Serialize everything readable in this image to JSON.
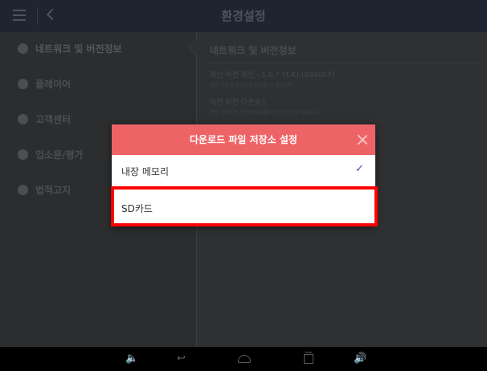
{
  "header": {
    "title": "환경설정"
  },
  "sidebar": {
    "items": [
      {
        "label": "네트워크 및 버전정보",
        "icon": "wifi-icon"
      },
      {
        "label": "플레이어",
        "icon": "play-icon"
      },
      {
        "label": "고객센터",
        "icon": "headset-icon"
      },
      {
        "label": "입소문/평가",
        "icon": "chat-icon"
      },
      {
        "label": "법적고지",
        "icon": "info-icon"
      }
    ]
  },
  "content": {
    "heading": "네트워크 및 버전정보",
    "rows": [
      {
        "title": "최신 버전 확인 - 1.0.7 (T-K) (934007)",
        "desc": "최신 버전을 확인하고 설치할 수 있습니다."
      },
      {
        "title": "이전 버전 다운로드",
        "desc": "최신 업데이트 이전의 파일을 다운로드 할 수 있습니다."
      }
    ]
  },
  "dialog": {
    "title": "다운로드 파일 저장소 설정",
    "options": [
      {
        "label": "내장 메모리",
        "selected": true
      },
      {
        "label": "SD카드",
        "selected": false
      }
    ],
    "check_glyph": "✓"
  },
  "navbar": {
    "volume_down": "🔈",
    "back": "↩",
    "volume_up": "🔊"
  },
  "colors": {
    "dialog_header": "#ee6365",
    "highlight": "#ff0000",
    "check": "#3f51b5"
  }
}
